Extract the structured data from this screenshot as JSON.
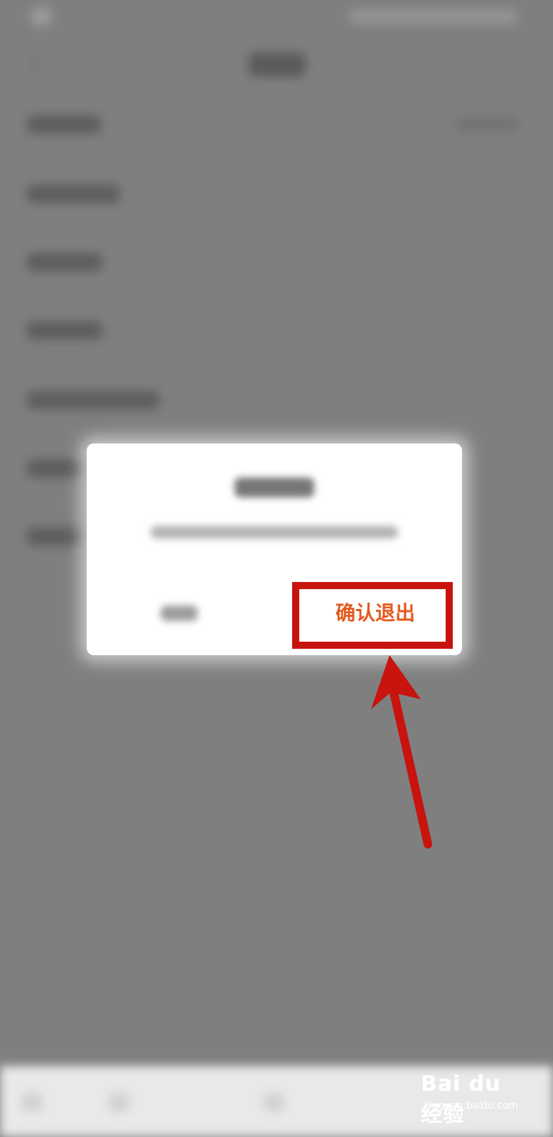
{
  "dialog": {
    "confirm_label": "确认退出"
  },
  "annotation": {
    "color": "#c8130e"
  },
  "watermark": {
    "brand": "Bai du 经验",
    "url": "jingyan.baidu.com"
  },
  "icons": {
    "back": "back-arrow-icon",
    "paw": "baidu-paw-icon"
  }
}
